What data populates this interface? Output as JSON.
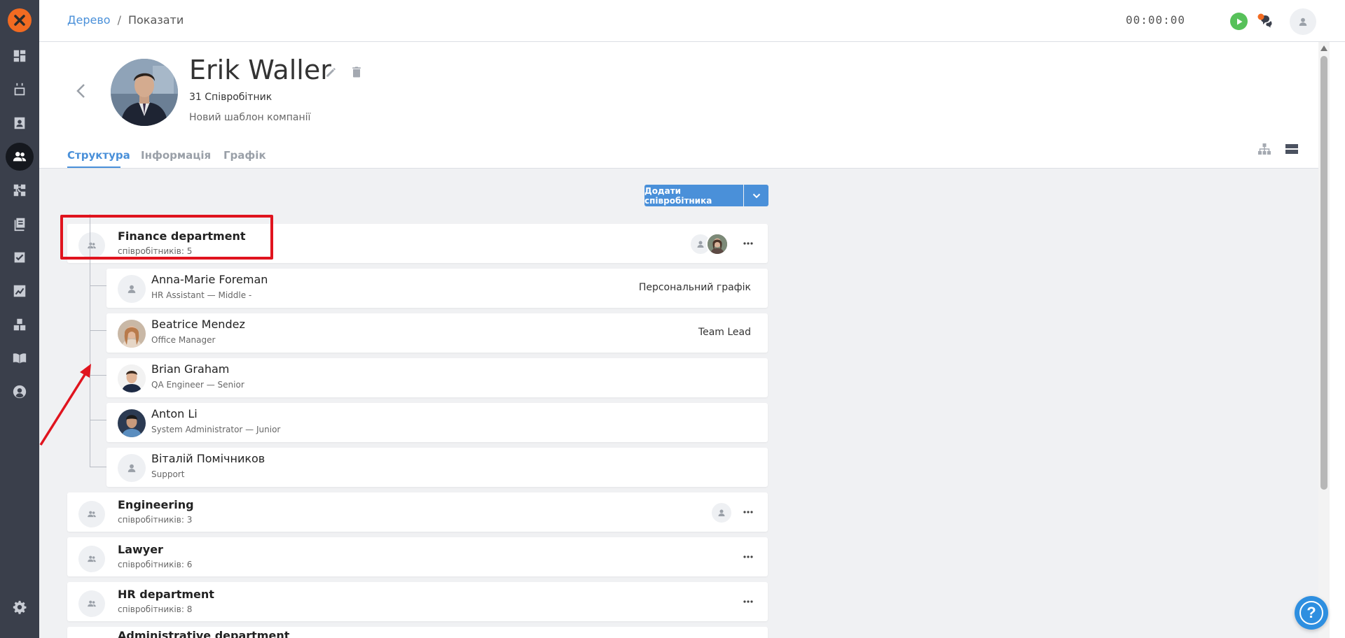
{
  "breadcrumb": {
    "root": "Дерево",
    "separator": "/",
    "current": "Показати"
  },
  "timer": "00:00:00",
  "profile": {
    "name": "Erik Waller",
    "employee_count": "31 Співробітник",
    "template": "Новий шаблон компанії"
  },
  "tabs": [
    {
      "label": "Структура",
      "active": true
    },
    {
      "label": "Інформація",
      "active": false
    },
    {
      "label": "Графік",
      "active": false
    }
  ],
  "toolbar": {
    "add_employee_label": "Додати співробітника"
  },
  "departments": [
    {
      "name": "Finance department",
      "count": "співробітників: 5"
    },
    {
      "name": "Engineering",
      "count": "співробітників: 3"
    },
    {
      "name": "Lawyer",
      "count": "співробітників: 6"
    },
    {
      "name": "HR department",
      "count": "співробітників: 8"
    },
    {
      "name": "Administrative department",
      "count": ""
    }
  ],
  "employees": [
    {
      "name": "Anna-Marie Foreman",
      "role": "HR Assistant — Middle -",
      "tag": "Персональний графік"
    },
    {
      "name": "Beatrice Mendez",
      "role": "Office Manager",
      "tag": "Team Lead"
    },
    {
      "name": "Brian Graham",
      "role": "QA Engineer — Senior",
      "tag": ""
    },
    {
      "name": "Anton Li",
      "role": "System Administrator — Junior",
      "tag": ""
    },
    {
      "name": "Віталій Помічников",
      "role": "Support",
      "tag": ""
    }
  ],
  "help": {
    "label": "?"
  },
  "colors": {
    "accent": "#4a90d9",
    "sidebar": "#3a3f4b",
    "highlight": "#e0141e",
    "logo": "#f26b21"
  }
}
